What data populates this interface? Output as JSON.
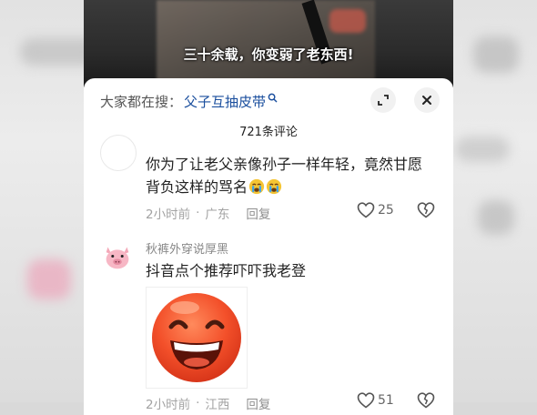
{
  "video": {
    "subtitle": "三十余载，你变弱了老东西!"
  },
  "search": {
    "label": "大家都在搜：",
    "term": "父子互抽皮带"
  },
  "comments_header": {
    "count_label": "721条评论"
  },
  "comments": [
    {
      "text": "你为了让老父亲像孙子一样年轻，竟然甘愿背负这样的骂名",
      "emojis": [
        "crying-face-emoji",
        "crying-face-emoji"
      ],
      "time": "2小时前",
      "location": "广东",
      "reply_label": "回复",
      "likes": "25"
    },
    {
      "username": "秋裤外穿说厚黑",
      "text": "抖音点个推荐吓吓我老登",
      "image": "grinning-face-emoji",
      "time": "2小时前",
      "location": "江西",
      "reply_label": "回复",
      "likes": "51"
    }
  ],
  "colors": {
    "search_term": "#1b4f9e",
    "panel_bg": "#ffffff",
    "meta_text": "#a3a3a3"
  }
}
